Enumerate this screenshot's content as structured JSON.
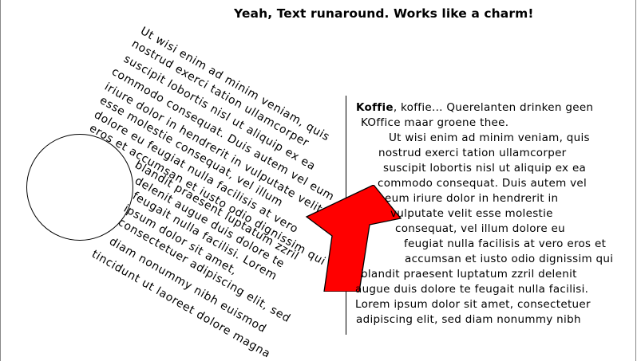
{
  "title": "Yeah, Text runaround. Works like a charm!",
  "left_frame": {
    "lines": [
      "Ut wisi enim ad minim veniam, quis",
      "nostrud exerci tation ullamcorper",
      "suscipit lobortis nisl ut aliquip ex ea",
      "commodo consequat. Duis autem vel eum",
      "iriure dolor in hendrerit in vulputate velit",
      "esse molestie consequat, vel illum",
      "dolore eu feugiat nulla facilisis at vero",
      "eros et accumsan et iusto odio dignissim qui",
      "blandit praesent luptatum zzril",
      "delenit augue duis dolore te",
      "feugait nulla facilisi. Lorem",
      "ipsum dolor sit amet,",
      "consectetuer adipiscing elit, sed",
      "diam nonummy nibh euismod",
      "tincidunt ut laoreet dolore magna"
    ]
  },
  "right_frame": {
    "first_bold": "Koffie",
    "first_rest": ", koffie... Querelanten drinken geen",
    "lines": [
      "KOffice maar groene thee.",
      "Ut wisi enim ad minim veniam, quis",
      "nostrud exerci tation ullamcorper",
      "suscipit lobortis nisl ut aliquip ex ea",
      "commodo consequat. Duis autem vel",
      "eum iriure dolor in hendrerit in",
      "vulputate velit esse molestie",
      "consequat, vel illum dolore eu",
      "feugiat nulla facilisis at vero eros et",
      "accumsan et iusto odio dignissim qui",
      "blandit praesent luptatum zzril delenit",
      "augue duis dolore te feugait nulla facilisi.",
      "Lorem ipsum dolor sit amet, consectetuer",
      "adipiscing elit, sed diam nonummy nibh"
    ]
  },
  "colors": {
    "arrow_fill": "#ff0000",
    "stroke": "#000000"
  },
  "shapes": {
    "circle": "ellipse",
    "arrow": "arrow-up-left-icon"
  }
}
